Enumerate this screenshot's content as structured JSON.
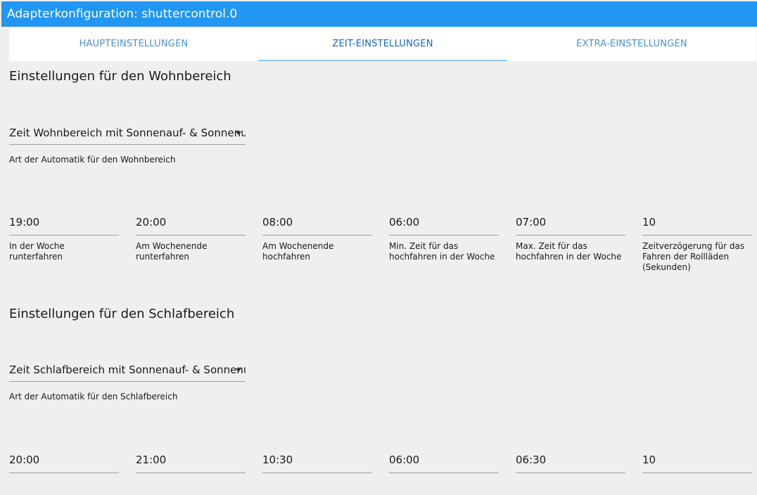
{
  "window": {
    "title": "Adapterkonfiguration: shuttercontrol.0"
  },
  "tabs": [
    {
      "label": "HAUPTEINSTELLUNGEN",
      "active": false
    },
    {
      "label": "ZEIT-EINSTELLUNGEN",
      "active": true
    },
    {
      "label": "EXTRA-EINSTELLUNGEN",
      "active": false
    }
  ],
  "living": {
    "title": "Einstellungen für den Wohnbereich",
    "select_value": "Zeit Wohnbereich mit Sonnenauf- & Sonnenuntergang",
    "select_help": "Art der Automatik für den Wohnbereich",
    "fields": [
      {
        "value": "19:00",
        "label": "In der Woche runterfahren"
      },
      {
        "value": "20:00",
        "label": "Am Wochenende runterfahren"
      },
      {
        "value": "08:00",
        "label": "Am Wochenende hochfahren"
      },
      {
        "value": "06:00",
        "label": "Min. Zeit für das hochfahren in der Woche"
      },
      {
        "value": "07:00",
        "label": "Max. Zeit für das hochfahren in der Woche"
      },
      {
        "value": "10",
        "label": "Zeitverzögerung für das Fahren der Rollläden (Sekunden)"
      }
    ]
  },
  "sleep": {
    "title": "Einstellungen für den Schlafbereich",
    "select_value": "Zeit Schlafbereich mit Sonnenauf- & Sonnenuntergang",
    "select_help": "Art der Automatik für den Schlafbereich",
    "fields": [
      {
        "value": "20:00"
      },
      {
        "value": "21:00"
      },
      {
        "value": "10:30"
      },
      {
        "value": "06:00"
      },
      {
        "value": "06:30"
      },
      {
        "value": "10"
      }
    ]
  }
}
